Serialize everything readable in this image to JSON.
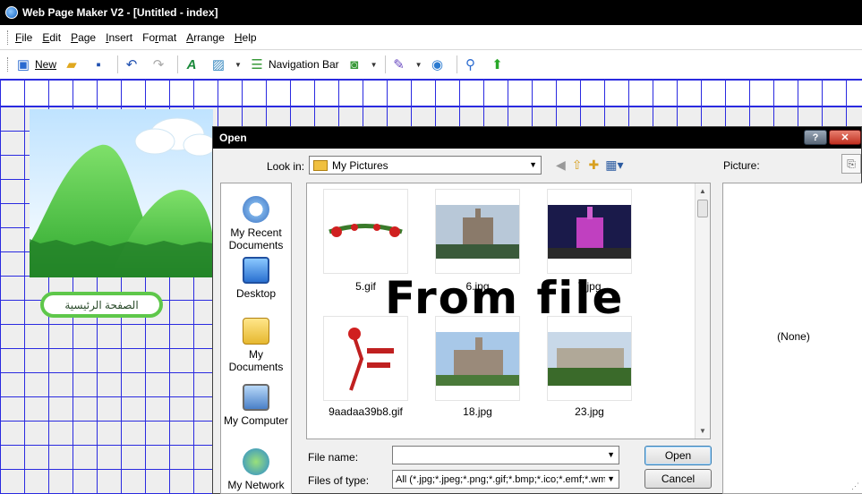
{
  "window": {
    "title": "Web Page Maker V2 - [Untitled - index]"
  },
  "menu": [
    {
      "pre": "",
      "u": "F",
      "post": "ile"
    },
    {
      "pre": "",
      "u": "E",
      "post": "dit"
    },
    {
      "pre": "",
      "u": "P",
      "post": "age"
    },
    {
      "pre": "",
      "u": "I",
      "post": "nsert"
    },
    {
      "pre": "Fo",
      "u": "r",
      "post": "mat"
    },
    {
      "pre": "",
      "u": "A",
      "post": "rrange"
    },
    {
      "pre": "",
      "u": "H",
      "post": "elp"
    }
  ],
  "toolbar": {
    "new_label": "New",
    "nav_bar_label": "Navigation Bar"
  },
  "page": {
    "nav_button_label": "الصفحة الرئيسية"
  },
  "dialog": {
    "title": "Open",
    "help_label": "?",
    "close_label": "✕",
    "look_in_label": "Look in:",
    "look_in_value": "My Pictures",
    "places": [
      {
        "label": "My Recent Documents",
        "icon": "recent-documents-icon"
      },
      {
        "label": "Desktop",
        "icon": "desktop-icon"
      },
      {
        "label": "My Documents",
        "icon": "my-documents-icon"
      },
      {
        "label": "My Computer",
        "icon": "my-computer-icon"
      },
      {
        "label": "My Network",
        "icon": "my-network-icon"
      }
    ],
    "files": [
      {
        "name": "5.gif"
      },
      {
        "name": "6.jpg"
      },
      {
        "name": "7.jpg"
      },
      {
        "name": "9aadaa39b8.gif"
      },
      {
        "name": "18.jpg"
      },
      {
        "name": "23.jpg"
      }
    ],
    "file_name_label": "File name:",
    "file_name_value": "",
    "files_of_type_label": "Files of type:",
    "files_of_type_value": "All (*.jpg;*.jpeg;*.png;*.gif;*.bmp;*.ico;*.emf;*.wm",
    "open_label": "Open",
    "cancel_label": "Cancel",
    "picture_label": "Picture:",
    "picture_value": "(None)"
  },
  "overlay": {
    "text": "From file"
  },
  "colors": {
    "grid": "#2a2ae0",
    "title_bar": "#000000",
    "nav_pill_border": "#5ec74a"
  }
}
